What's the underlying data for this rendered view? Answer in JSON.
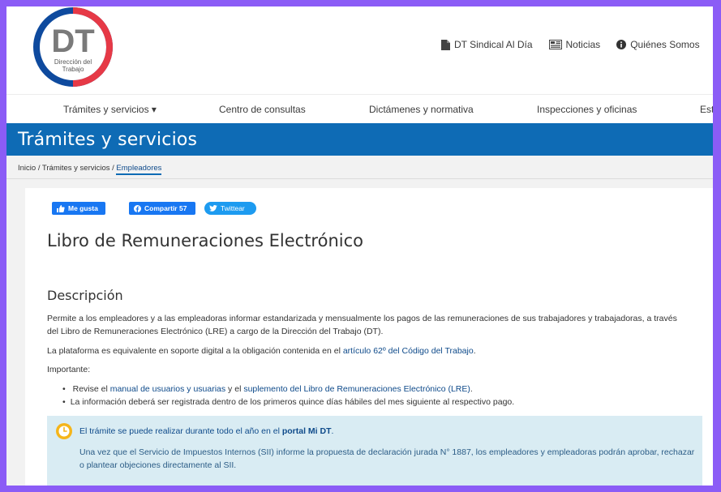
{
  "logo": {
    "initials": "DT",
    "line1": "Dirección del",
    "line2": "Trabajo",
    "colors": {
      "blue": "#0e4a9e",
      "red": "#e63946"
    }
  },
  "toplinks": [
    {
      "label": "DT Sindical Al Día",
      "icon": "document-icon"
    },
    {
      "label": "Noticias",
      "icon": "newspaper-icon"
    },
    {
      "label": "Quiénes Somos",
      "icon": "info-circle-icon"
    },
    {
      "label": "",
      "icon": "chat-icon"
    }
  ],
  "nav": {
    "items": [
      "Trámites y servicios ▾",
      "Centro de consultas",
      "Dictámenes y normativa",
      "Inspecciones y oficinas",
      "Est"
    ]
  },
  "banner": {
    "title": "Trámites y servicios"
  },
  "breadcrumb": {
    "prefix": "Inicio / Trámites y servicios / ",
    "current": "Empleadores"
  },
  "social": {
    "like": "Me gusta",
    "share": "Compartir 57",
    "tweet": "Twittear"
  },
  "page": {
    "title": "Libro de Remuneraciones Electrónico",
    "section": "Descripción",
    "p1": "Permite a los empleadores y a las empleadoras informar estandarizada y mensualmente los pagos de las remuneraciones de sus trabajadores y trabajadoras, a través del Libro de Remuneraciones Electrónico (LRE) a cargo de la Dirección del Trabajo (DT).",
    "p2_text": "La plataforma es equivalente en soporte digital a la obligación contenida en el ",
    "p2_link": "artículo 62º del Código del Trabajo",
    "p2_end": ".",
    "important": "Importante:",
    "b1_a": "Revise el ",
    "b1_link1": "manual de usuarios y usuarias",
    "b1_b": " y el ",
    "b1_link2": "suplemento del Libro de Remuneraciones Electrónico (LRE)",
    "b1_end": ".",
    "b2": "La información deberá ser registrada dentro de los primeros quince días hábiles del mes siguiente al respectivo pago."
  },
  "info": {
    "l1_text": "El trámite se puede realizar durante todo el año en el ",
    "l1_link": "portal Mi DT",
    "l1_end": ".",
    "l2": "Una vez que el Servicio de Impuestos Internos (SII) informe la propuesta de declaración jurada N° 1887, los empleadores y empleadoras podrán aprobar, rechazar o plantear objeciones directamente al SII.",
    "colors": {
      "bg": "#d9ecf3",
      "clock": "#f5b51a"
    }
  }
}
